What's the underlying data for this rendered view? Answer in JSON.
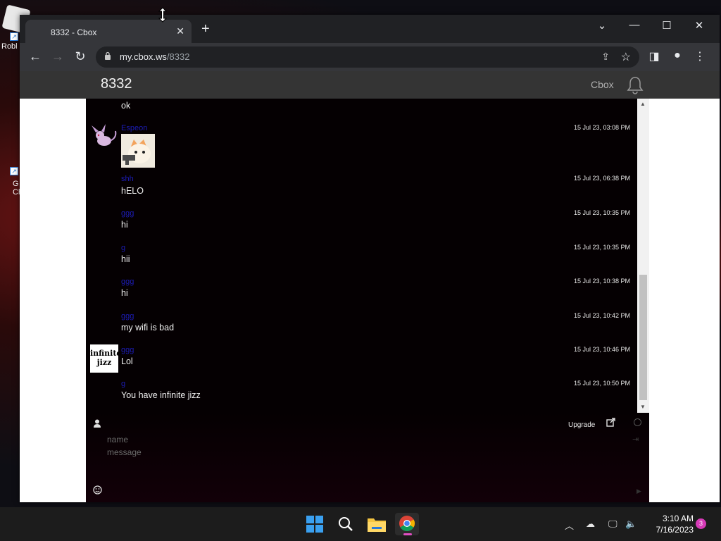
{
  "desktop": {
    "icons": [
      {
        "label": "Robl",
        "badge": "↗"
      },
      {
        "label": "G\nCh",
        "badge": "↗"
      }
    ]
  },
  "browser": {
    "tab_title": "8332 - Cbox",
    "url_host": "my.cbox.ws",
    "url_path": "/8332"
  },
  "cbox": {
    "box_name": "8332",
    "brand": "Cbox",
    "messages": [
      {
        "user": "",
        "text": "ok",
        "time": "",
        "avatar": ""
      },
      {
        "user": "Espeon",
        "text": "",
        "time": "15 Jul 23, 03:08 PM",
        "avatar": "espeon",
        "sticker": true
      },
      {
        "user": "shh",
        "text": "hELO",
        "time": "15 Jul 23, 06:38 PM",
        "avatar": ""
      },
      {
        "user": "ggg",
        "text": "hi",
        "time": "15 Jul 23, 10:35 PM",
        "avatar": ""
      },
      {
        "user": "g",
        "text": "hii",
        "time": "15 Jul 23, 10:35 PM",
        "avatar": ""
      },
      {
        "user": "ggg",
        "text": "hi",
        "time": "15 Jul 23, 10:38 PM",
        "avatar": ""
      },
      {
        "user": "ggg",
        "text": "my wifi is bad",
        "time": "15 Jul 23, 10:42 PM",
        "avatar": ""
      },
      {
        "user": "ggg",
        "text": "Lol",
        "time": "15 Jul 23, 10:46 PM",
        "avatar": "infinite",
        "avatar_text": "infinite jizz"
      },
      {
        "user": "g",
        "text": "You have infinite jizz",
        "time": "15 Jul 23, 10:50 PM",
        "avatar": ""
      }
    ],
    "composer": {
      "upgrade_label": "Upgrade",
      "name_placeholder": "name",
      "message_placeholder": "message"
    }
  },
  "taskbar": {
    "time": "3:10 AM",
    "date": "7/16/2023",
    "notification_count": "3",
    "apps": [
      "start-icon",
      "search-icon",
      "file-explorer-icon",
      "chrome-icon"
    ]
  },
  "colors": {
    "chat_bg": "#050002",
    "username": "#1c1cb5",
    "header_bg": "#343434",
    "chrome_frame": "#202124",
    "notification": "#d63ab7"
  }
}
